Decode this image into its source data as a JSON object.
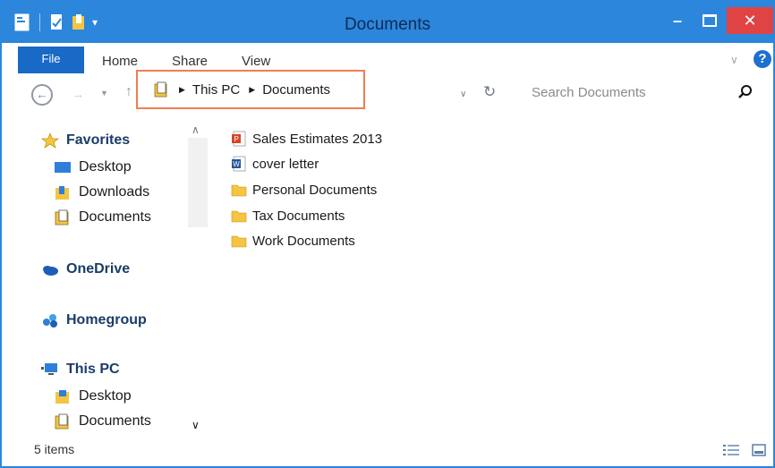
{
  "window": {
    "title": "Documents"
  },
  "ribbon": {
    "tabs": [
      {
        "label": "File"
      },
      {
        "label": "Home"
      },
      {
        "label": "Share"
      },
      {
        "label": "View"
      }
    ]
  },
  "address": {
    "crumbs": [
      "This PC",
      "Documents"
    ]
  },
  "search": {
    "placeholder": "Search Documents"
  },
  "navpane": {
    "favorites": {
      "label": "Favorites",
      "items": [
        "Desktop",
        "Downloads",
        "Documents"
      ]
    },
    "onedrive": "OneDrive",
    "homegroup": "Homegroup",
    "thispc": {
      "label": "This PC",
      "items": [
        "Desktop",
        "Documents"
      ]
    }
  },
  "files": [
    {
      "name": "Sales Estimates 2013",
      "icon": "powerpoint-icon"
    },
    {
      "name": "cover letter",
      "icon": "word-doc-icon"
    },
    {
      "name": "Personal Documents",
      "icon": "folder-icon"
    },
    {
      "name": "Tax Documents",
      "icon": "folder-icon"
    },
    {
      "name": "Work Documents",
      "icon": "folder-icon"
    }
  ],
  "status": {
    "items": "5 items"
  },
  "colors": {
    "titlebar": "#2b86dc",
    "file_tab": "#1969c6",
    "close": "#e04343",
    "highlight": "#f07d51",
    "folder": "#f5c542"
  }
}
